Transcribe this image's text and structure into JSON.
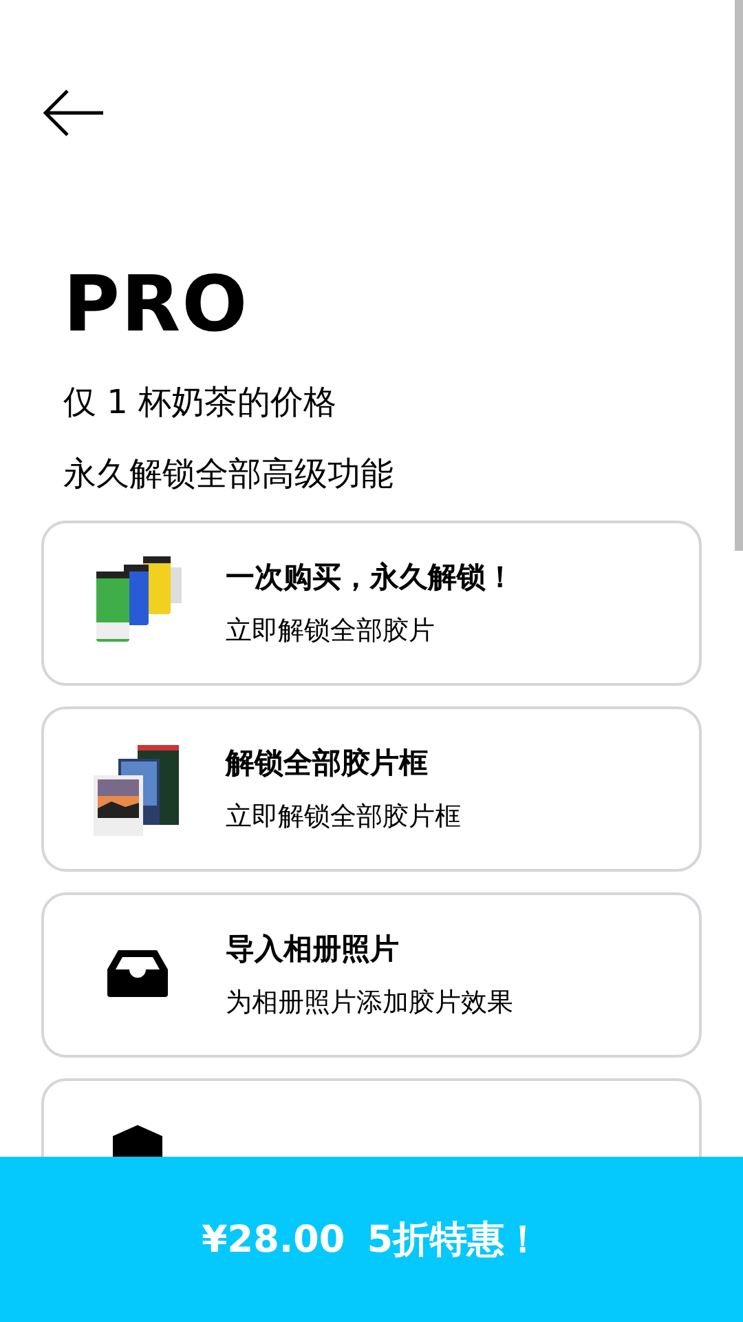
{
  "title": "PRO",
  "taglines": [
    "仅 1 杯奶茶的价格",
    "永久解锁全部高级功能"
  ],
  "features": [
    {
      "kind": "film-rolls",
      "title": "一次购买，永久解锁！",
      "subtitle": "立即解锁全部胶片"
    },
    {
      "kind": "photo-frames",
      "title": "解锁全部胶片框",
      "subtitle": "立即解锁全部胶片框"
    },
    {
      "kind": "tray",
      "title": "导入相册照片",
      "subtitle": "为相册照片添加胶片效果"
    },
    {
      "kind": "shield"
    }
  ],
  "buy_button": {
    "price": "¥28.00",
    "offer": "5折特惠！"
  }
}
